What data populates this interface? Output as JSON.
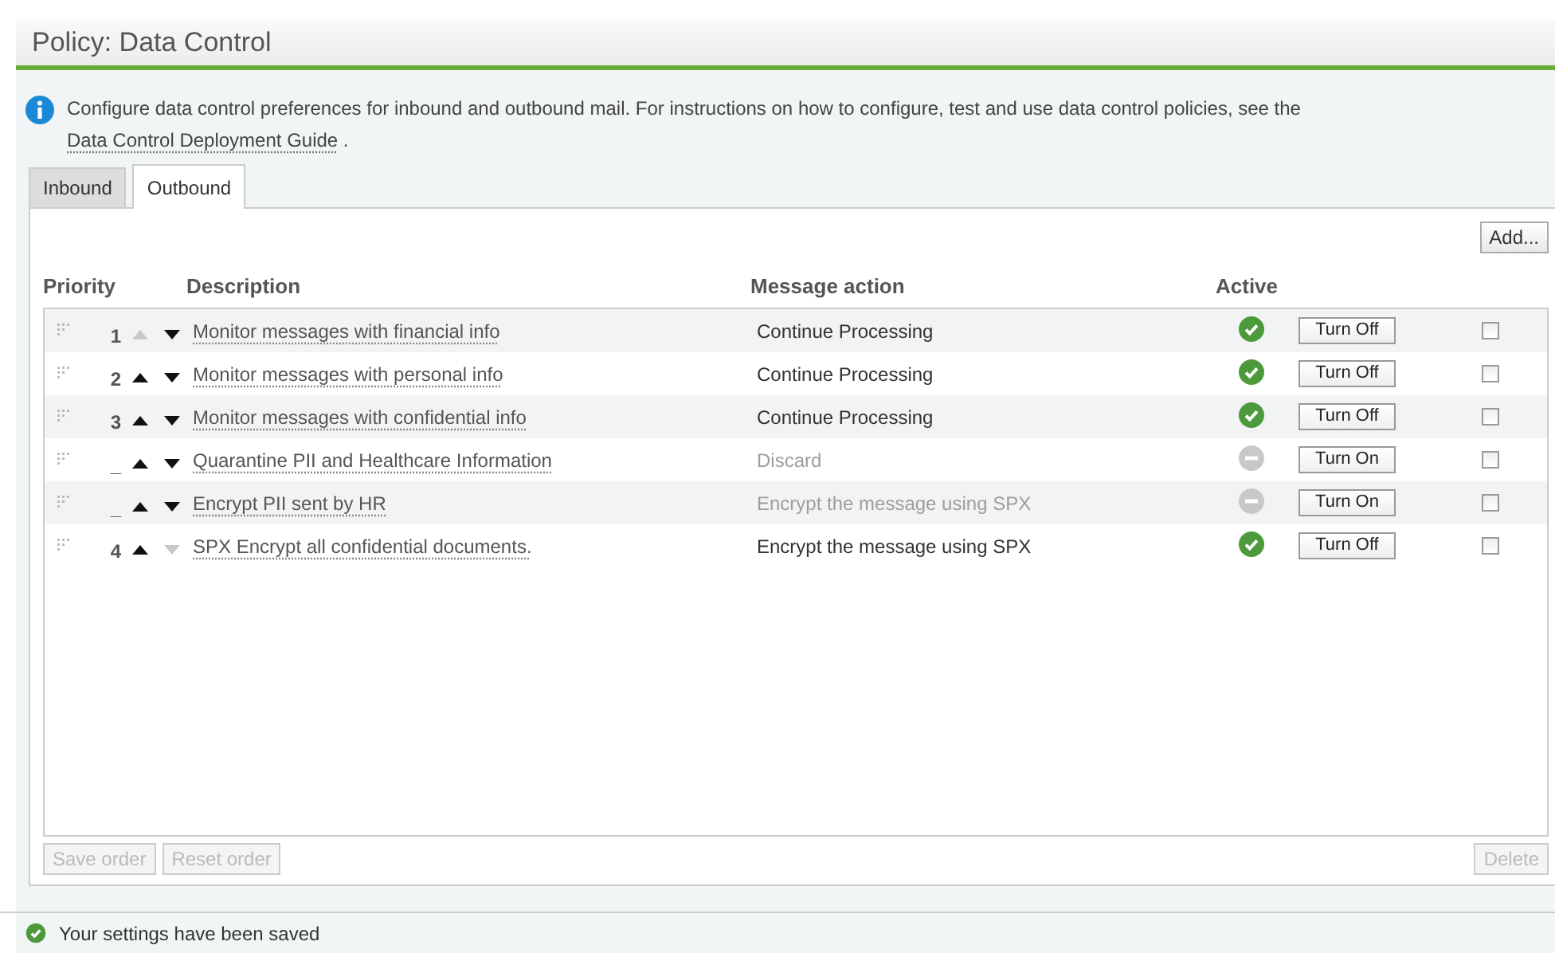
{
  "title": "Policy: Data Control",
  "info": {
    "text": "Configure data control preferences for inbound and outbound mail. For instructions on how to configure, test and use data control policies, see the",
    "link": "Data Control Deployment Guide",
    "after": "."
  },
  "tabs": [
    {
      "label": "Inbound",
      "selected": false
    },
    {
      "label": "Outbound",
      "selected": true
    }
  ],
  "add_button": "Add...",
  "columns": [
    "Priority",
    "Description",
    "Message action",
    "Active"
  ],
  "rows": [
    {
      "priority": "1",
      "up_enabled": false,
      "down_enabled": true,
      "description": "Monitor messages with financial info",
      "action": "Continue Processing",
      "active": true,
      "toggle": "Turn Off",
      "checked": false
    },
    {
      "priority": "2",
      "up_enabled": true,
      "down_enabled": true,
      "description": "Monitor messages with personal info",
      "action": "Continue Processing",
      "active": true,
      "toggle": "Turn Off",
      "checked": false
    },
    {
      "priority": "3",
      "up_enabled": true,
      "down_enabled": true,
      "description": "Monitor messages with confidential info",
      "action": "Continue Processing",
      "active": true,
      "toggle": "Turn Off",
      "checked": false
    },
    {
      "priority": "_",
      "up_enabled": true,
      "down_enabled": true,
      "description": "Quarantine PII and Healthcare Information",
      "action": "Discard",
      "active": false,
      "toggle": "Turn On",
      "checked": false
    },
    {
      "priority": "_",
      "up_enabled": true,
      "down_enabled": true,
      "description": "Encrypt PII sent by HR",
      "action": "Encrypt the message using SPX",
      "active": false,
      "toggle": "Turn On",
      "checked": false
    },
    {
      "priority": "4",
      "up_enabled": true,
      "down_enabled": false,
      "description": "SPX Encrypt all confidential documents.",
      "action": "Encrypt the message using SPX",
      "active": true,
      "toggle": "Turn Off",
      "checked": false
    }
  ],
  "footer_buttons": [
    {
      "label": "Save order",
      "disabled": true
    },
    {
      "label": "Reset order",
      "disabled": true
    }
  ],
  "delete_button": {
    "label": "Delete",
    "disabled": true
  },
  "status": "Your settings have been saved"
}
